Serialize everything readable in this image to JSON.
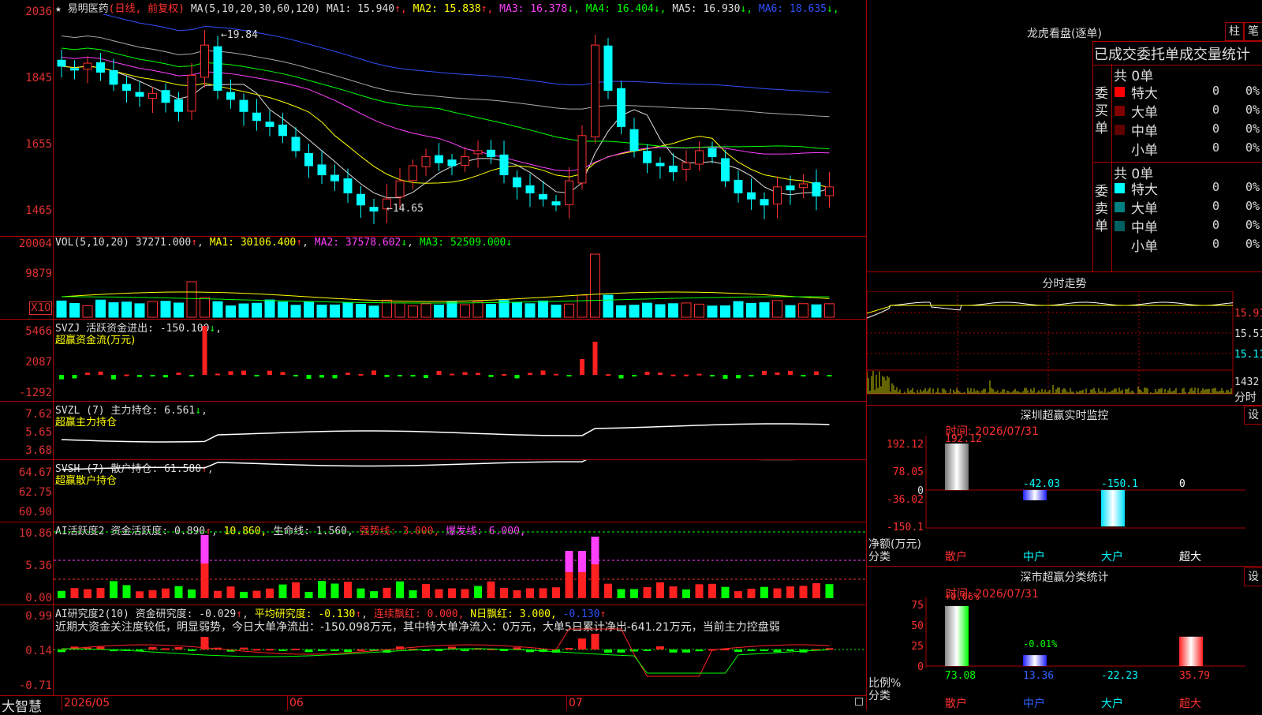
{
  "stock": {
    "name": "易明医药",
    "mode": "(日线, 前复权)",
    "star": "★"
  },
  "main": {
    "y_labels": [
      "2036",
      "1845",
      "1655",
      "1465"
    ],
    "ma_label": "MA(5,10,20,30,60,120)",
    "ma": [
      {
        "name": "MA1:",
        "value": "15.940",
        "arrow": "↑",
        "color": "#dddddd"
      },
      {
        "name": "MA2:",
        "value": "15.838",
        "arrow": "↑",
        "color": "#ffff00"
      },
      {
        "name": "MA3:",
        "value": "16.378",
        "arrow": "↓",
        "color": "#ff40ff"
      },
      {
        "name": "MA4:",
        "value": "16.404",
        "arrow": "↓",
        "color": "#00ff00"
      },
      {
        "name": "MA5:",
        "value": "16.930",
        "arrow": "↓",
        "color": "#dddddd"
      },
      {
        "name": "MA6:",
        "value": "18.635",
        "arrow": "↓",
        "color": "#3050ff"
      }
    ],
    "high_mark": "19.84",
    "low_mark": "14.65"
  },
  "vol": {
    "y_labels": [
      "20004",
      "9879"
    ],
    "x10": "X10",
    "label": "VOL(5,10,20)",
    "value": "37271.000",
    "ma1": "MA1: 30106.400",
    "ma2": "MA2: 37578.602",
    "ma3": "MA3: 52509.000"
  },
  "svzj": {
    "y_labels": [
      "5466",
      "2087",
      "-1292"
    ],
    "label": "SVZJ",
    "name": "活跃资金进出: -150.100",
    "sub": "超赢资金流(万元)"
  },
  "svzl": {
    "y_labels": [
      "7.62",
      "5.65",
      "3.68"
    ],
    "label": "SVZL (7)",
    "name": "主力持仓: 6.561",
    "sub": "超赢主力持仓"
  },
  "svsh": {
    "y_labels": [
      "64.67",
      "62.75",
      "60.90"
    ],
    "label": "SVSH (7)",
    "name": "散户持仓: 61.580",
    "sub": "超赢散户持仓"
  },
  "ai1": {
    "y_labels": [
      "10.86",
      "5.36",
      "0.00"
    ],
    "label": "AI活跃度2",
    "t1": "资金活跃度: 0.890",
    "t2": "10.860,",
    "t3": "生命线: 1.560,",
    "t4": "强势线: 3.000,",
    "t5": "爆发线: 6.000,"
  },
  "ai2": {
    "y_labels": [
      "0.99",
      "0.14",
      "-0.71"
    ],
    "label": "AI研究度2(10)",
    "t1": "资金研究度: -0.029",
    "t2": "平均研究度: -0.130",
    "t3": "连续飘红: 0.000,",
    "t4": "N日飘红: 3.000,",
    "t5": "-0.130",
    "comment": "近期大资金关注度较低，明显弱势，今日大单净流出：-150.098万元，其中特大单净流入：0万元，大单5日累计净出-641.21万元，当前主力控盘弱"
  },
  "bottom": {
    "brand": "大智慧",
    "dates": [
      "2026/05",
      "06",
      "07"
    ]
  },
  "dragon": {
    "title": "龙虎看盘(逐单)",
    "btn_column": "柱",
    "btn_pen": "笔",
    "tabs": "已成交委托单成交量统计",
    "buy_label": "委买单",
    "sell_label": "委卖单",
    "buy_total": "共 0单",
    "sell_total": "共 0单",
    "rows_buy": [
      {
        "name": "特大",
        "n": "0",
        "p": "0%",
        "color": "#ff0000"
      },
      {
        "name": "大单",
        "n": "0",
        "p": "0%",
        "color": "#800000"
      },
      {
        "name": "中单",
        "n": "0",
        "p": "0%",
        "color": "#600000"
      },
      {
        "name": "小单",
        "n": "0",
        "p": "0%",
        "color": "#000000"
      }
    ],
    "rows_sell": [
      {
        "name": "特大",
        "n": "0",
        "p": "0%",
        "color": "#00ffff"
      },
      {
        "name": "大单",
        "n": "0",
        "p": "0%",
        "color": "#008080"
      },
      {
        "name": "中单",
        "n": "0",
        "p": "0%",
        "color": "#006060"
      },
      {
        "name": "小单",
        "n": "0",
        "p": "0%",
        "color": "#000000"
      }
    ]
  },
  "intraday": {
    "title": "分时走势",
    "y_labels": [
      "15.91",
      "15.51",
      "15.11"
    ],
    "vol_label": "1432",
    "fen": "分时"
  },
  "szmon": {
    "title": "深圳超赢实时监控",
    "btn": "设",
    "time": "时间: 2026/07/31",
    "y_labels": [
      "192.12",
      "78.05",
      "0",
      "-36.02",
      "-150.1"
    ],
    "bars": [
      {
        "label": "192.12",
        "cat": "散户",
        "value": 192.12
      },
      {
        "label": "-42.03",
        "cat": "中户",
        "value": -42.03
      },
      {
        "label": "-150.1",
        "cat": "大户",
        "value": -150.1
      },
      {
        "label": "0",
        "cat": "超大",
        "value": 0
      }
    ],
    "axis1": "净额(万元)",
    "axis2": "分类"
  },
  "szstat": {
    "title": "深市超赢分类统计",
    "btn": "设",
    "time": "时间: 2026/07/31",
    "y_labels": [
      "75",
      "50",
      "25",
      "0"
    ],
    "top_labels": [
      "+0.06%",
      "-0.01%"
    ],
    "bars": [
      {
        "cat": "散户",
        "value": 73.08,
        "label": "73.08"
      },
      {
        "cat": "中户",
        "value": 13.36,
        "label": "13.36"
      },
      {
        "cat": "大户",
        "value": -22.23,
        "label": "-22.23"
      },
      {
        "cat": "超大",
        "value": 35.79,
        "label": "35.79"
      }
    ],
    "axis1": "比例%",
    "axis2": "分类"
  }
}
